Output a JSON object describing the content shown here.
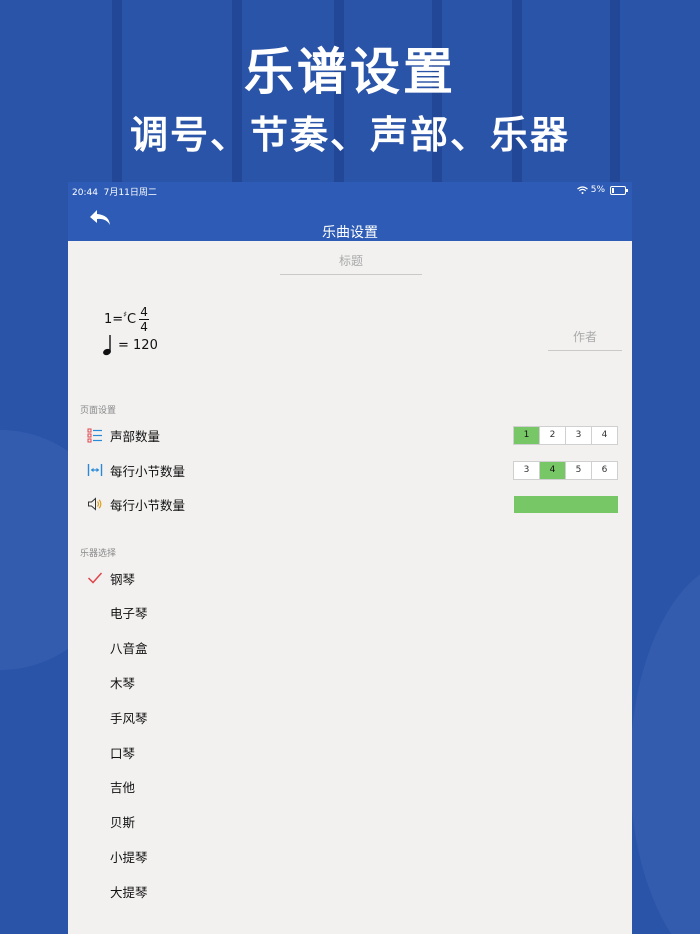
{
  "promo": {
    "title": "乐谱设置",
    "subtitle": "调号、节奏、声部、乐器"
  },
  "statusbar": {
    "time": "20:44",
    "date": "7月11日周二",
    "battery": "5%"
  },
  "navbar": {
    "title": "乐曲设置",
    "back_icon": "back-arrow-icon"
  },
  "score": {
    "title_placeholder": "标题",
    "author_placeholder": "作者",
    "key_prefix": "1=",
    "key_sharp": "♯",
    "key_note": "C",
    "time_top": "4",
    "time_bottom": "4",
    "tempo_note": "♩",
    "tempo_text": "= 120"
  },
  "page_settings": {
    "header": "页面设置",
    "rows": [
      {
        "label": "声部数量",
        "icon": "list-icon",
        "options": [
          "1",
          "2",
          "3",
          "4"
        ],
        "selected": "1"
      },
      {
        "label": "每行小节数量",
        "icon": "width-arrows-icon",
        "options": [
          "3",
          "4",
          "5",
          "6"
        ],
        "selected": "4"
      },
      {
        "label": "每行小节数量",
        "icon": "speaker-icon",
        "volume_level": 1.0
      }
    ]
  },
  "instruments": {
    "header": "乐器选择",
    "selected": "钢琴",
    "items": [
      "钢琴",
      "电子琴",
      "八音盒",
      "木琴",
      "手风琴",
      "口琴",
      "吉他",
      "贝斯",
      "小提琴",
      "大提琴"
    ]
  },
  "colors": {
    "brand_blue": "#2d5bb5",
    "background_blue": "#2a54a8",
    "active_green": "#78c766",
    "check_red": "#e0454a",
    "icon_blue": "#2a8ad8",
    "panel_bg": "#f2f1f0"
  }
}
